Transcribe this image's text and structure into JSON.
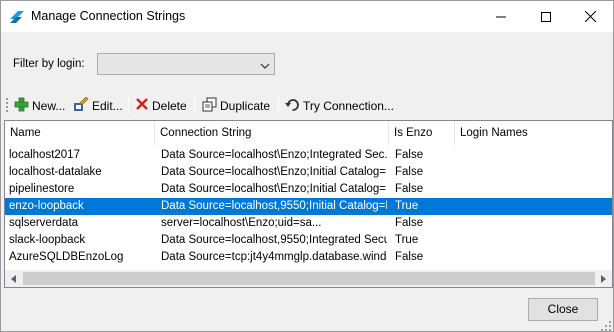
{
  "window": {
    "title": "Manage Connection Strings",
    "controls": {
      "minimize": "minimize-icon",
      "maximize": "maximize-icon",
      "close": "close-icon"
    }
  },
  "filter": {
    "label": "Filter by login:",
    "selected": ""
  },
  "toolbar": {
    "new_label": "New...",
    "edit_label": "Edit...",
    "delete_label": "Delete",
    "duplicate_label": "Duplicate",
    "try_label": "Try Connection..."
  },
  "table": {
    "headers": [
      "Name",
      "Connection String",
      "Is Enzo",
      "Login Names"
    ],
    "rows": [
      {
        "name": "localhost2017",
        "conn": "Data Source=localhost\\Enzo;Integrated Sec...",
        "is_enzo": "False",
        "logins": ""
      },
      {
        "name": "localhost-datalake",
        "conn": "Data Source=localhost\\Enzo;Initial Catalog=...",
        "is_enzo": "False",
        "logins": ""
      },
      {
        "name": "pipelinestore",
        "conn": "Data Source=localhost\\Enzo;Initial Catalog=...",
        "is_enzo": "False",
        "logins": ""
      },
      {
        "name": "enzo-loopback",
        "conn": "Data Source=localhost,9550;Initial Catalog=B...",
        "is_enzo": "True",
        "logins": "",
        "selected": true
      },
      {
        "name": "sqlserverdata",
        "conn": "server=localhost\\Enzo;uid=sa...",
        "is_enzo": "False",
        "logins": ""
      },
      {
        "name": "slack-loopback",
        "conn": "Data Source=localhost,9550;Integrated Secu...",
        "is_enzo": "True",
        "logins": ""
      },
      {
        "name": "AzureSQLDBEnzoLog",
        "conn": "Data Source=tcp:jt4y4mmglp.database.windo...",
        "is_enzo": "False",
        "logins": ""
      }
    ]
  },
  "footer": {
    "close_label": "Close"
  },
  "colors": {
    "selection": "#0078d7",
    "window_bg": "#f0f0f0",
    "delete_red": "#cc2222",
    "add_green": "#3aa23a"
  }
}
